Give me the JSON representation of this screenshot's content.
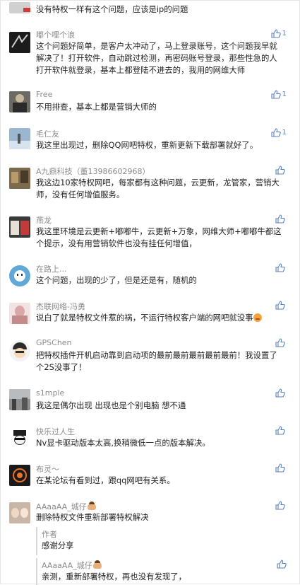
{
  "comments": [
    {
      "name": "",
      "text": "没有特权一样有这个问题，应该是ip的问题",
      "likes": "",
      "avatar_color": "#d0d0d0"
    },
    {
      "name": "嘟个哩个浪",
      "text": "这个问题好简单，是客户太冲动了，马上登录账号，这个问题我早就解决了！打开软件，自动跳过检测，再密码账号登录，那些性急的人打开软件就登录，基本上都登陆不进去的，我用的网维大师",
      "likes": "1",
      "avatar_color": "#1b1b1b"
    },
    {
      "name": "Free",
      "text": "不用排查，基本上都是营销大师的",
      "likes": "1",
      "avatar_color": "#6b6a63"
    },
    {
      "name": "毛仁友",
      "text": "我这里出现过，删除QQ网吧特权，重新更新下载部署就好了。",
      "likes": "1",
      "avatar_color": "#9bb6cf"
    },
    {
      "name": "A九鼎科技（董13986602968）",
      "text": "我这边10家特权网吧，每家都有这种问题，云更新，龙管家，营销大师，没有任何增值服务。",
      "likes": "",
      "avatar_color": "#7d6b4f"
    },
    {
      "name": "燕龙",
      "text": "我这里环境是云更新+嘟嘟牛，云更新+万象，网维大师+嘟嘟牛都这个提示，没有用营销软件也没有挂任何增值，",
      "likes": "",
      "avatar_color": "#3a3a3a"
    },
    {
      "name": "在路上...",
      "text": "这个问题，出现的少了，但是还是有，随机的",
      "likes": "",
      "avatar_color": "#5fa8d8"
    },
    {
      "name": "杰联网络-冯勇",
      "text": "说白了就是特权文件惹的祸，不运行特权客户端的网吧就没事",
      "likes": "",
      "avatar_color": "#e7c8c8"
    },
    {
      "name": "GPSChen",
      "text": "把特权插件开机启动靠到启动项的最前最前最前最前最前！我设置了个2S没事了！",
      "likes": "",
      "avatar_color": "#2b2b2b"
    },
    {
      "name": "s1mple",
      "text": "我这是偶尔出现 出现也是个别电脑 想不通",
      "likes": "",
      "avatar_color": "#8f8f8f"
    },
    {
      "name": "快乐过人生",
      "text": "Nv显卡驱动版本太高,换稍微低一点的版本解决。",
      "likes": "",
      "avatar_color": "#ffffff"
    },
    {
      "name": "布灵～",
      "text": "在某论坛有看到过，跟qq网吧有关系。",
      "likes": "",
      "avatar_color": "#1a1a1a"
    },
    {
      "name": "AAaaAA_城仔",
      "text": "删除特权文件重新部署特权解决",
      "likes": "",
      "avatar_color": "#c9b6a6"
    }
  ],
  "replies": [
    {
      "name": "作者",
      "text": "感谢分享"
    },
    {
      "name": "AAaaAA_城仔",
      "text": "亲测，重新部署特权，再也没有发现了，"
    }
  ],
  "colors": {
    "like": "#5a7fbd",
    "name": "#8a8a8a",
    "text": "#1f1f1f"
  }
}
